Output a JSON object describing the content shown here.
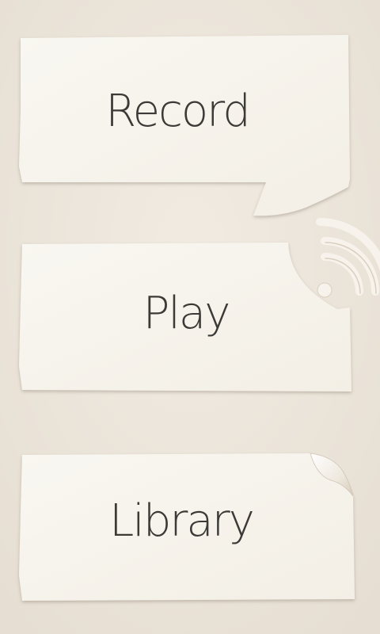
{
  "menu": {
    "record_label": "Record",
    "play_label": "Play",
    "library_label": "Library"
  },
  "icons": {
    "record": "speech-bubble-icon",
    "play": "broadcast-waves-icon",
    "library": "curled-page-corner-icon"
  },
  "colors": {
    "background": "#ece5da",
    "paper": "#f8f5ee",
    "text": "#3c3a37"
  }
}
